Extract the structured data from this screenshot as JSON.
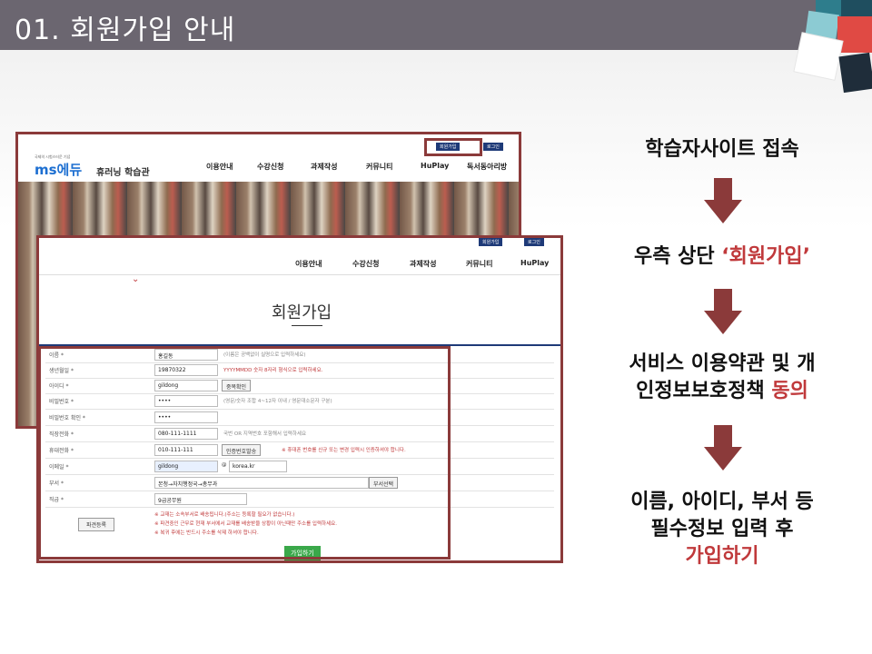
{
  "slide": {
    "title": "01. 회원가입 안내"
  },
  "back_page": {
    "top_buttons": [
      "회원가입",
      "로그인"
    ],
    "logo_tag": "국제의 시험스터운 기념",
    "logo_brand": "ms에듀",
    "logo_name": "휴러닝 학습관",
    "nav": [
      "이용안내",
      "수강신청",
      "과제작성",
      "커뮤니티",
      "HuPlay",
      "독서동아리방"
    ]
  },
  "front_page": {
    "top_buttons": [
      "회원가입",
      "로그인"
    ],
    "nav": [
      "이용안내",
      "수강신청",
      "과제작성",
      "커뮤니티",
      "HuPlay"
    ],
    "heading": "회원가입",
    "form": {
      "rows": [
        {
          "label": "이름 *",
          "value": "홍길동",
          "hint": "(이름은 공백없이 실명으로 입력하세요)"
        },
        {
          "label": "생년월일 *",
          "value": "19870322",
          "hint": "YYYYMMDD 숫자 8자리 형식으로 입력하세요."
        },
        {
          "label": "아이디 *",
          "value": "gildong",
          "button": "중복확인"
        },
        {
          "label": "비밀번호 *",
          "value": "••••",
          "hint": "(영문/숫자 조합 4~12자 이내 / 영문대소문자 구분)"
        },
        {
          "label": "비밀번호 확인 *",
          "value": "••••"
        },
        {
          "label": "직장전화 *",
          "value": "080-111-1111",
          "hint": "국번 OR 지역번호 포함해서 입력하세요"
        },
        {
          "label": "휴대전화 *",
          "value": "010-111-111",
          "button": "인증번호발송",
          "hint": "※ 휴대폰 번호를 신규 또는 변경 입력시 인증하셔야 합니다."
        },
        {
          "label": "이메일 *",
          "value": "gildong",
          "at": "@",
          "select": "korea.kr"
        },
        {
          "label": "부서 *",
          "value": "본청→자치행정국→총무과",
          "button": "부서선택"
        },
        {
          "label": "직급 *",
          "select": "9급공무원"
        }
      ],
      "notes": [
        "※ 교재는 소속부서로 배송됩니다.(주소는 등록할 필요가 없습니다.)",
        "※ 파견중인 근무로 현재 부서에서 교재를 배송받을 상황이 아닌때만 주소를 입력하세요.",
        "※ 복귀 후에는 반드시 주소를 삭제 하셔야 합니다."
      ],
      "dispatch_button": "파견등록",
      "submit_button": "가입하기"
    }
  },
  "steps": [
    {
      "text": "학습자사이트 접속"
    },
    {
      "prefix": "우측 상단 ",
      "highlight": "‘회원가입’"
    },
    {
      "line1": "서비스 이용약관 및 개",
      "line2_prefix": "인정보보호정책 ",
      "line2_highlight": "동의"
    },
    {
      "line1": "이름, 아이디, 부서 등",
      "line2": "필수정보 입력 후",
      "line3_highlight": "가입하기"
    }
  ],
  "colors": {
    "accent": "#8b3a3a",
    "highlight": "#c0393b",
    "submit": "#3aa84a",
    "nav_btn": "#1e3a78"
  }
}
